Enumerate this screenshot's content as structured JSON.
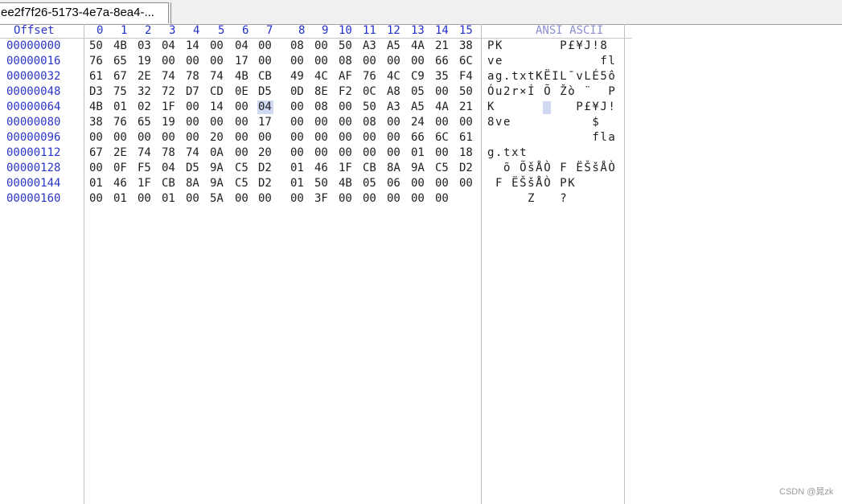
{
  "tab": {
    "title": "ee2f7f26-5173-4e7a-8ea4-..."
  },
  "header": {
    "offset_label": "Offset",
    "columns": [
      "0",
      "1",
      "2",
      "3",
      "4",
      "5",
      "6",
      "7",
      "8",
      "9",
      "10",
      "11",
      "12",
      "13",
      "14",
      "15"
    ],
    "ascii_label": "ANSI ASCII"
  },
  "rows": [
    {
      "offset": "00000000",
      "bytes": [
        "50",
        "4B",
        "03",
        "04",
        "14",
        "00",
        "04",
        "00",
        "08",
        "00",
        "50",
        "A3",
        "A5",
        "4A",
        "21",
        "38"
      ],
      "ascii": "PK       P£¥J!8"
    },
    {
      "offset": "00000016",
      "bytes": [
        "76",
        "65",
        "19",
        "00",
        "00",
        "00",
        "17",
        "00",
        "00",
        "00",
        "08",
        "00",
        "00",
        "00",
        "66",
        "6C"
      ],
      "ascii": "ve            fl"
    },
    {
      "offset": "00000032",
      "bytes": [
        "61",
        "67",
        "2E",
        "74",
        "78",
        "74",
        "4B",
        "CB",
        "49",
        "4C",
        "AF",
        "76",
        "4C",
        "C9",
        "35",
        "F4"
      ],
      "ascii": "ag.txtKËIL¯vLÉ5ô"
    },
    {
      "offset": "00000048",
      "bytes": [
        "D3",
        "75",
        "32",
        "72",
        "D7",
        "CD",
        "0E",
        "D5",
        "0D",
        "8E",
        "F2",
        "0C",
        "A8",
        "05",
        "00",
        "50"
      ],
      "ascii": "Óu2r×Í Õ Žò ¨  P"
    },
    {
      "offset": "00000064",
      "bytes": [
        "4B",
        "01",
        "02",
        "1F",
        "00",
        "14",
        "00",
        "04",
        "00",
        "08",
        "00",
        "50",
        "A3",
        "A5",
        "4A",
        "21"
      ],
      "ascii": "K          P£¥J!"
    },
    {
      "offset": "00000080",
      "bytes": [
        "38",
        "76",
        "65",
        "19",
        "00",
        "00",
        "00",
        "17",
        "00",
        "00",
        "00",
        "08",
        "00",
        "24",
        "00",
        "00"
      ],
      "ascii": "8ve          $  "
    },
    {
      "offset": "00000096",
      "bytes": [
        "00",
        "00",
        "00",
        "00",
        "00",
        "20",
        "00",
        "00",
        "00",
        "00",
        "00",
        "00",
        "00",
        "66",
        "6C",
        "61"
      ],
      "ascii": "             fla"
    },
    {
      "offset": "00000112",
      "bytes": [
        "67",
        "2E",
        "74",
        "78",
        "74",
        "0A",
        "00",
        "20",
        "00",
        "00",
        "00",
        "00",
        "00",
        "01",
        "00",
        "18"
      ],
      "ascii": "g.txt           "
    },
    {
      "offset": "00000128",
      "bytes": [
        "00",
        "0F",
        "F5",
        "04",
        "D5",
        "9A",
        "C5",
        "D2",
        "01",
        "46",
        "1F",
        "CB",
        "8A",
        "9A",
        "C5",
        "D2"
      ],
      "ascii": "  õ ÕšÅÒ F ËŠšÅÒ"
    },
    {
      "offset": "00000144",
      "bytes": [
        "01",
        "46",
        "1F",
        "CB",
        "8A",
        "9A",
        "C5",
        "D2",
        "01",
        "50",
        "4B",
        "05",
        "06",
        "00",
        "00",
        "00"
      ],
      "ascii": " F ËŠšÅÒ PK    "
    },
    {
      "offset": "00000160",
      "bytes": [
        "00",
        "01",
        "00",
        "01",
        "00",
        "5A",
        "00",
        "00",
        "00",
        "3F",
        "00",
        "00",
        "00",
        "00",
        "00",
        ""
      ],
      "ascii": "     Z   ?      "
    }
  ],
  "selection": {
    "row": 4,
    "col": 7
  },
  "watermark": "CSDN @晁zk",
  "colors": {
    "offset": "#2a35c8",
    "header": "#2030c8",
    "highlight": "#d0d8f2"
  }
}
